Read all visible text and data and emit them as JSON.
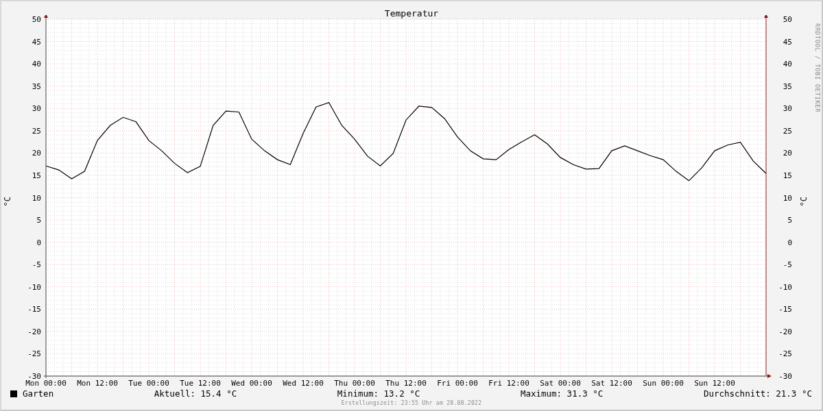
{
  "chart": {
    "title": "Temperatur",
    "ylabel_left": "°C",
    "ylabel_right": "°C",
    "credit": "RRDTOOL / TOBI OETIKER",
    "chart_data": {
      "type": "line",
      "categories": [
        "Mon 00:00",
        null,
        null,
        null,
        "Mon 12:00",
        null,
        null,
        null,
        "Tue 00:00",
        null,
        null,
        null,
        "Tue 12:00",
        null,
        null,
        null,
        "Wed 00:00",
        null,
        null,
        null,
        "Wed 12:00",
        null,
        null,
        null,
        "Thu 00:00",
        null,
        null,
        null,
        "Thu 12:00",
        null,
        null,
        null,
        "Fri 00:00",
        null,
        null,
        null,
        "Fri 12:00",
        null,
        null,
        null,
        "Sat 00:00",
        null,
        null,
        null,
        "Sat 12:00",
        null,
        null,
        null,
        "Sun 00:00",
        null,
        null,
        null,
        "Sun 12:00",
        null,
        null,
        null,
        null
      ],
      "series": [
        {
          "name": "Garten",
          "color": "#000000",
          "values": [
            17.1,
            16.2,
            14.2,
            15.9,
            22.8,
            26.2,
            28.0,
            27.0,
            22.8,
            20.5,
            17.7,
            15.6,
            17.0,
            26.2,
            29.4,
            29.2,
            23.1,
            20.5,
            18.5,
            17.4,
            24.4,
            30.3,
            31.3,
            26.2,
            23.1,
            19.3,
            17.1,
            19.9,
            27.4,
            30.5,
            30.2,
            27.7,
            23.6,
            20.5,
            18.7,
            18.5,
            20.8,
            22.5,
            24.1,
            22.0,
            19.0,
            17.4,
            16.4,
            16.5,
            20.5,
            21.6,
            20.5,
            19.4,
            18.5,
            15.9,
            13.8,
            16.7,
            20.5,
            21.8,
            22.4,
            18.2,
            15.4
          ]
        }
      ],
      "ylim": [
        -30,
        50
      ],
      "grid": true,
      "yticks": [
        -30,
        -25,
        -20,
        -15,
        -10,
        -5,
        0,
        5,
        10,
        15,
        20,
        25,
        30,
        35,
        40,
        45,
        50
      ]
    },
    "right_axis_labels": [
      "50",
      "45",
      "40",
      "35",
      "30",
      "25",
      "20",
      "15",
      "10",
      "5",
      "0",
      "-5",
      "-10",
      "-15",
      "-20",
      "-25",
      "-30"
    ]
  },
  "legend": {
    "stats": [
      "Aktuell: 15.4 °C",
      "Minimum: 13.2 °C",
      "Maximum: 31.3 °C",
      "Durchschnitt: 21.3 °C"
    ]
  },
  "footer": "Erstellungszeit: 23:55 Uhr am 28.08.2022"
}
